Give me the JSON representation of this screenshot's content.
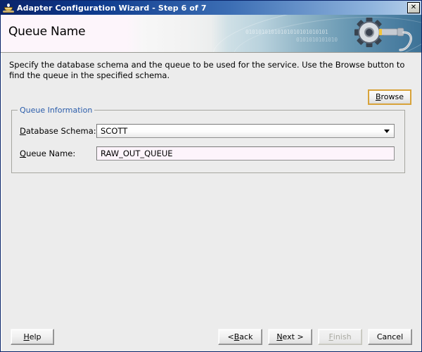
{
  "window": {
    "title": "Adapter Configuration Wizard - Step 6 of 7",
    "icon": "coffee-cup-icon",
    "close_label": "✕"
  },
  "banner": {
    "heading": "Queue Name",
    "binary_line1": "01010101010101010101010101",
    "binary_line2": "0101010101010",
    "graphic": "gear-with-plug-icon"
  },
  "main": {
    "instructions": "Specify the database schema and the queue to be used for the service. Use the Browse button to find the queue in the specified schema.",
    "browse": {
      "label_before": "B",
      "mnemonic": "B",
      "label": "rowse",
      "full_label": "Browse"
    },
    "group": {
      "legend": "Queue Information",
      "fields": [
        {
          "name": "database-schema",
          "label_mnemonic": "D",
          "label_rest": "atabase Schema:",
          "label_full": "Database Schema:",
          "type": "combobox",
          "value": "SCOTT"
        },
        {
          "name": "queue-name",
          "label_mnemonic": "Q",
          "label_rest": "ueue Name:",
          "label_full": "Queue Name:",
          "type": "textfield",
          "value": "RAW_OUT_QUEUE"
        }
      ]
    }
  },
  "footer": {
    "help": {
      "mnemonic": "H",
      "rest": "elp",
      "full": "Help"
    },
    "back": {
      "prefix": "< ",
      "mnemonic": "B",
      "rest": "ack",
      "full": "< Back"
    },
    "next": {
      "mnemonic": "N",
      "rest": "ext >",
      "full": "Next >"
    },
    "finish": {
      "mnemonic": "F",
      "rest": "inish",
      "full": "Finish",
      "disabled": true
    },
    "cancel": {
      "full": "Cancel"
    }
  },
  "colors": {
    "titlebar_start": "#0a246a",
    "titlebar_end": "#b8d0ea",
    "legend_blue": "#2a5caa",
    "focus_gold": "#d8a33a",
    "dialog_bg": "#ececec",
    "queue_field_bg": "#fdf4fb"
  }
}
